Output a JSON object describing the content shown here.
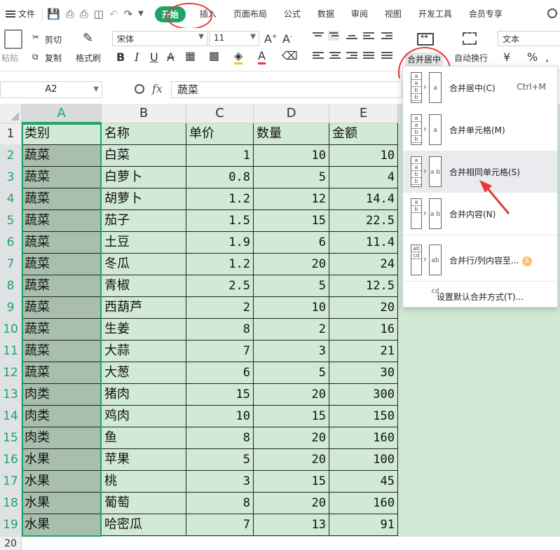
{
  "menubar": {
    "file_label": "文件",
    "tabs": [
      "开始",
      "插入",
      "页面布局",
      "公式",
      "数据",
      "审阅",
      "视图",
      "开发工具",
      "会员专享"
    ],
    "active_tab": "开始"
  },
  "ribbon": {
    "paste_label": "粘贴",
    "cut_label": "剪切",
    "copy_label": "复制",
    "format_painter_label": "格式刷",
    "font_name": "宋体",
    "font_size": "11",
    "merge_label": "合并居中",
    "wrap_label": "自动换行",
    "number_format": "文本",
    "currency_symbol": "¥",
    "percent_symbol": "%"
  },
  "formula_bar": {
    "name_box": "A2",
    "fx_label": "fx",
    "formula_value": "蔬菜"
  },
  "grid": {
    "columns": [
      "A",
      "B",
      "C",
      "D",
      "E"
    ],
    "active_column": "A",
    "rows": [
      {
        "n": "1",
        "cells": [
          "类别",
          "名称",
          "单价",
          "数量",
          "金额"
        ]
      },
      {
        "n": "2",
        "cells": [
          "蔬菜",
          "白菜",
          "1",
          "10",
          "10"
        ]
      },
      {
        "n": "3",
        "cells": [
          "蔬菜",
          "白萝卜",
          "0.8",
          "5",
          "4"
        ]
      },
      {
        "n": "4",
        "cells": [
          "蔬菜",
          "胡萝卜",
          "1.2",
          "12",
          "14.4"
        ]
      },
      {
        "n": "5",
        "cells": [
          "蔬菜",
          "茄子",
          "1.5",
          "15",
          "22.5"
        ]
      },
      {
        "n": "6",
        "cells": [
          "蔬菜",
          "土豆",
          "1.9",
          "6",
          "11.4"
        ]
      },
      {
        "n": "7",
        "cells": [
          "蔬菜",
          "冬瓜",
          "1.2",
          "20",
          "24"
        ]
      },
      {
        "n": "8",
        "cells": [
          "蔬菜",
          "青椒",
          "2.5",
          "5",
          "12.5"
        ]
      },
      {
        "n": "9",
        "cells": [
          "蔬菜",
          "西葫芦",
          "2",
          "10",
          "20"
        ]
      },
      {
        "n": "10",
        "cells": [
          "蔬菜",
          "生姜",
          "8",
          "2",
          "16"
        ]
      },
      {
        "n": "11",
        "cells": [
          "蔬菜",
          "大蒜",
          "7",
          "3",
          "21"
        ]
      },
      {
        "n": "12",
        "cells": [
          "蔬菜",
          "大葱",
          "6",
          "5",
          "30"
        ]
      },
      {
        "n": "13",
        "cells": [
          "肉类",
          "猪肉",
          "15",
          "20",
          "300"
        ]
      },
      {
        "n": "14",
        "cells": [
          "肉类",
          "鸡肉",
          "10",
          "15",
          "150"
        ]
      },
      {
        "n": "15",
        "cells": [
          "肉类",
          "鱼",
          "8",
          "20",
          "160"
        ]
      },
      {
        "n": "16",
        "cells": [
          "水果",
          "苹果",
          "5",
          "20",
          "100"
        ]
      },
      {
        "n": "17",
        "cells": [
          "水果",
          "桃",
          "3",
          "15",
          "45"
        ]
      },
      {
        "n": "18",
        "cells": [
          "水果",
          "葡萄",
          "8",
          "20",
          "160"
        ]
      },
      {
        "n": "19",
        "cells": [
          "水果",
          "哈密瓜",
          "7",
          "13",
          "91"
        ]
      }
    ],
    "extra_row": "20"
  },
  "merge_menu": {
    "items": [
      {
        "label": "合并居中(C)",
        "shortcut": "Ctrl+M"
      },
      {
        "label": "合并单元格(M)",
        "shortcut": ""
      },
      {
        "label": "合并相同单元格(S)",
        "shortcut": ""
      },
      {
        "label": "合并内容(N)",
        "shortcut": ""
      },
      {
        "label": "合并行/列内容至...",
        "shortcut": ""
      }
    ],
    "footer": "设置默认合并方式(T)...",
    "hovered_index": 2
  },
  "colors": {
    "accent": "#21a366",
    "sheet_bg": "#d1ead6",
    "selected_col_bg": "#a9bfae",
    "annotation": "#e53935"
  }
}
